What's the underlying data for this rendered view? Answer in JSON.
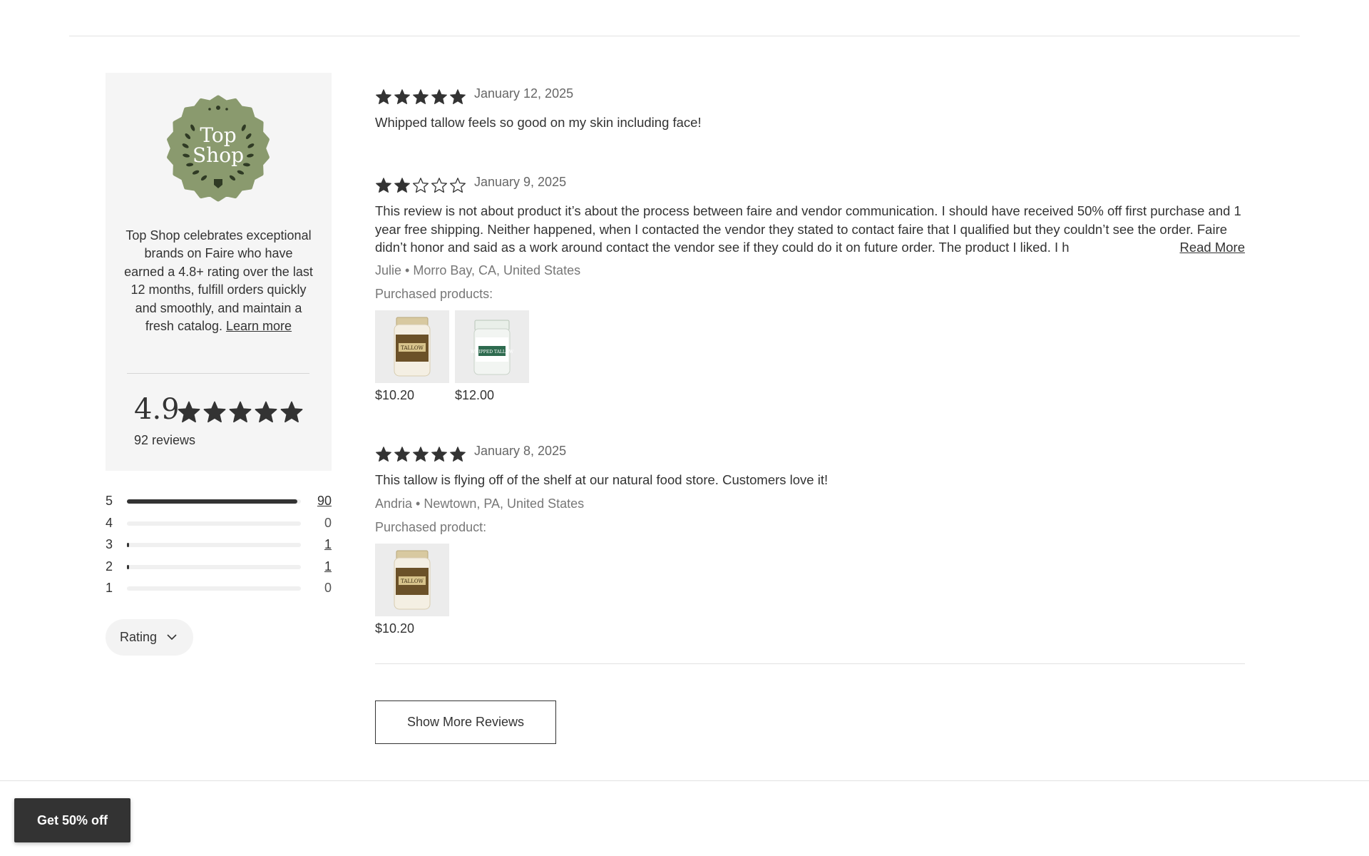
{
  "badge": {
    "logo_line1": "Top",
    "logo_line2": "Shop",
    "description": "Top Shop celebrates exceptional brands on Faire who have earned a 4.8+ rating over the last 12 months, fulfill orders quickly and smoothly, and maintain a fresh catalog.",
    "learn_more": "Learn more",
    "badge_color": "#8a9a6e"
  },
  "summary": {
    "rating": "4.9",
    "review_count": "92 reviews"
  },
  "distribution": [
    {
      "stars": "5",
      "count": "90",
      "fraction": 0.978,
      "link": true
    },
    {
      "stars": "4",
      "count": "0",
      "fraction": 0,
      "link": false
    },
    {
      "stars": "3",
      "count": "1",
      "fraction": 0.011,
      "link": true
    },
    {
      "stars": "2",
      "count": "1",
      "fraction": 0.011,
      "link": true
    },
    {
      "stars": "1",
      "count": "0",
      "fraction": 0,
      "link": false
    }
  ],
  "filter": {
    "label": "Rating"
  },
  "reviews": [
    {
      "stars": 5,
      "date": "January 12, 2025",
      "text": "Whipped tallow feels so good on my skin including face!"
    },
    {
      "stars": 2,
      "date": "January 9, 2025",
      "text": "This review is not about product it’s about the process between faire and vendor communication. I should have received 50% off first purchase and 1 year free shipping. Neither happened, when I contacted the vendor they stated to contact faire that I qualified but they couldn’t see the order. Faire didn’t honor and said as a work around contact the vendor see if they could do it on future order. The product I liked. I h",
      "read_more": "Read More",
      "author": "Julie • Morro Bay, CA, United States",
      "purchased_label": "Purchased products:",
      "products": [
        {
          "price": "$10.20",
          "label": "TALLOW"
        },
        {
          "price": "$12.00",
          "label": "WHIPPED TALLOW"
        }
      ]
    },
    {
      "stars": 5,
      "date": "January 8, 2025",
      "text": "This tallow is flying off of the shelf at our natural food store. Customers love it!",
      "author": "Andria • Newtown, PA, United States",
      "purchased_label": "Purchased product:",
      "products": [
        {
          "price": "$10.20",
          "label": "TALLOW"
        }
      ]
    }
  ],
  "show_more": "Show More Reviews",
  "promo": "Get 50% off",
  "colors": {
    "star": "#333333",
    "text": "#333333",
    "muted": "#777777",
    "panel_bg": "#f5f5f5"
  }
}
